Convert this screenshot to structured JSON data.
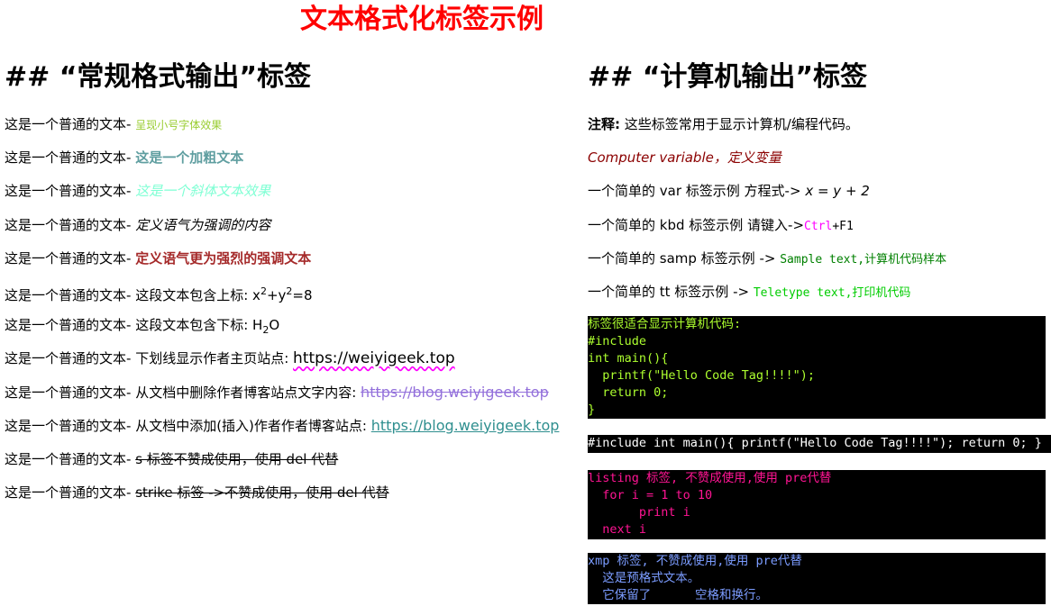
{
  "title": "文本格式化标签示例",
  "left": {
    "heading": "## “常规格式输出”标签",
    "prefix": "这是一个普通的文本-",
    "rows": {
      "small": "呈现小号字体效果",
      "bold": "这是一个加粗文本",
      "italic": "这是一个斜体文本效果",
      "em": "定义语气为强调的内容",
      "strong": "定义语气更为强烈的强调文本",
      "sup_lead": "这段文本包含上标:",
      "sup_x": "x",
      "sup_2a": "2",
      "sup_plus": "+y",
      "sup_2b": "2",
      "sup_tail": "=8",
      "sub_lead": "这段文本包含下标:",
      "sub_h": "H",
      "sub_2": "2",
      "sub_o": "O",
      "u_lead": "下划线显示作者主页站点:",
      "u_link": "https://weiyigeek.top",
      "del_lead": "从文档中删除作者博客站点文字内容:",
      "del_link": "https://blog.weiyigeek.top",
      "ins_lead": "从文档中添加(插入)作者作者博客站点:",
      "ins_link": "https://blog.weiyigeek.top",
      "s_tag": "s 标签不赞成使用，使用 del 代替",
      "strike_tag": "strike 标签 ->不赞成使用，使用 del 代替"
    }
  },
  "right": {
    "heading": "## “计算机输出”标签",
    "note_label": "注释:",
    "note_text": "这些标签常用于显示计算机/编程代码。",
    "cvar": "Computer variable，定义变量",
    "var_lead": "一个简单的 var 标签示例 方程式->",
    "var_eq": "x = y + 2",
    "kbd_lead": "一个简单的 kbd 标签示例 请键入->",
    "kbd_ctrl": "Ctrl",
    "kbd_plus": "+F1",
    "samp_lead": "一个简单的 samp 标签示例 ->",
    "samp_text": "Sample text,计算机代码样本",
    "tt_lead": "一个简单的 tt 标签示例 ->",
    "tt_text": "Teletype text,打印机代码",
    "code1": "标签很适合显示计算机代码:\n#include\nint main(){\n  printf(\"Hello Code Tag!!!!\");\n  return 0;\n}",
    "code2": "#include int main(){ printf(\"Hello Code Tag!!!!\"); return 0; }",
    "code3": "listing 标签, 不赞成使用,使用 pre代替\n  for i = 1 to 10\n       print i\n  next i",
    "code4": "xmp 标签, 不赞成使用,使用 pre代替\n  这是预格式文本。\n  它保留了      空格和换行。"
  }
}
